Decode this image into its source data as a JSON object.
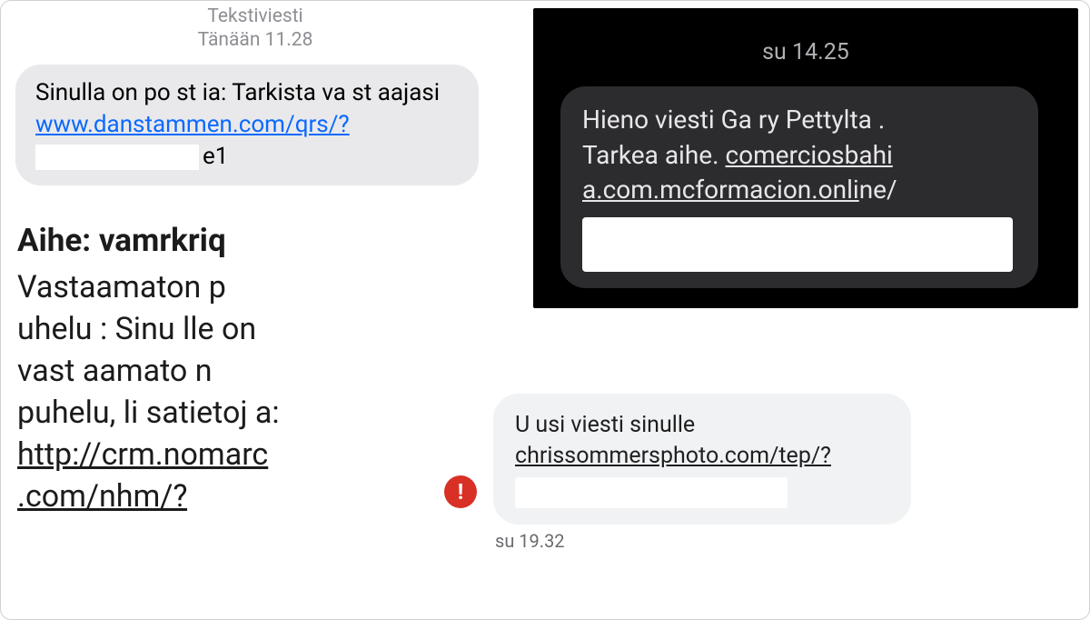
{
  "top_left": {
    "header_line1": "Tekstiviesti",
    "header_line2": "Tänään 11.28",
    "text_before_link": "Sinulla  on po st ia:  Tarkista va st aajasi  ",
    "link": "www.danstammen.com/qrs/?",
    "trailing": "e1"
  },
  "email": {
    "subject_label": "Aihe: vamrkriq",
    "body_line1": "Vastaamaton  p",
    "body_line2": "uhelu : Sinu lle  on",
    "body_line3": "vast aamato n",
    "body_line4": "puhelu, li satietoj a:",
    "link_line1": "http://crm.nomarc",
    "link_line2": ".com/nhm/?"
  },
  "dark": {
    "timestamp": "su 14.25",
    "text_line1": "Hieno viesti  Ga ry   Pettylta .",
    "text_prefix2": "Tarkea aihe.  ",
    "link_part1": "comerciosbahi",
    "link_part2": "a.com.mcformacion.onli",
    "link_plain_tail": "ne/"
  },
  "warn": {
    "text": "U  usi viesti sinulle",
    "link": "chrissommersphoto.com/tep/?",
    "timestamp": "su 19.32"
  }
}
